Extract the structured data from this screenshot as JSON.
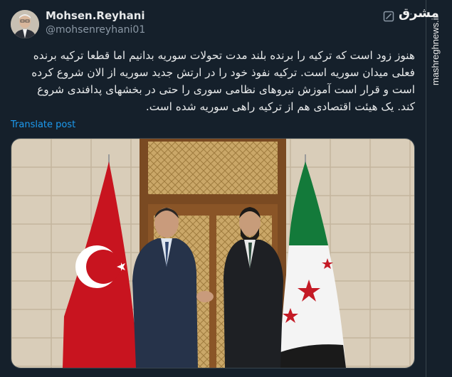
{
  "author": {
    "display_name": "Mohsen.Reyhani",
    "handle": "@mohsenreyhani01"
  },
  "tweet": {
    "lines": [
      "هنوز زود است که ترکیه را برنده بلند مدت تحولات سوریه بدانیم اما قطعا ترکیه برنده",
      "فعلی میدان سوریه است. ترکیه نفوذ خود را در ارتش جدید سوریه از الان شروع کرده",
      "است و قرار است آموزش نیروهای نظامی سوری را حتی در بخشهای پدافندی شروع",
      "کند. یک هیئت اقتصادی هم از ترکیه راهی سوریه شده است."
    ],
    "translate_label": "Translate post"
  },
  "toolbar": {
    "more_icon": "more-icon",
    "grok_icon": "grok-icon"
  },
  "watermark": {
    "logo": "مشرق",
    "site": "mashreghnews.ir"
  },
  "colors": {
    "background": "#15202b",
    "text": "#e7e9ea",
    "muted": "#8b98a5",
    "link": "#1d9bf0"
  }
}
